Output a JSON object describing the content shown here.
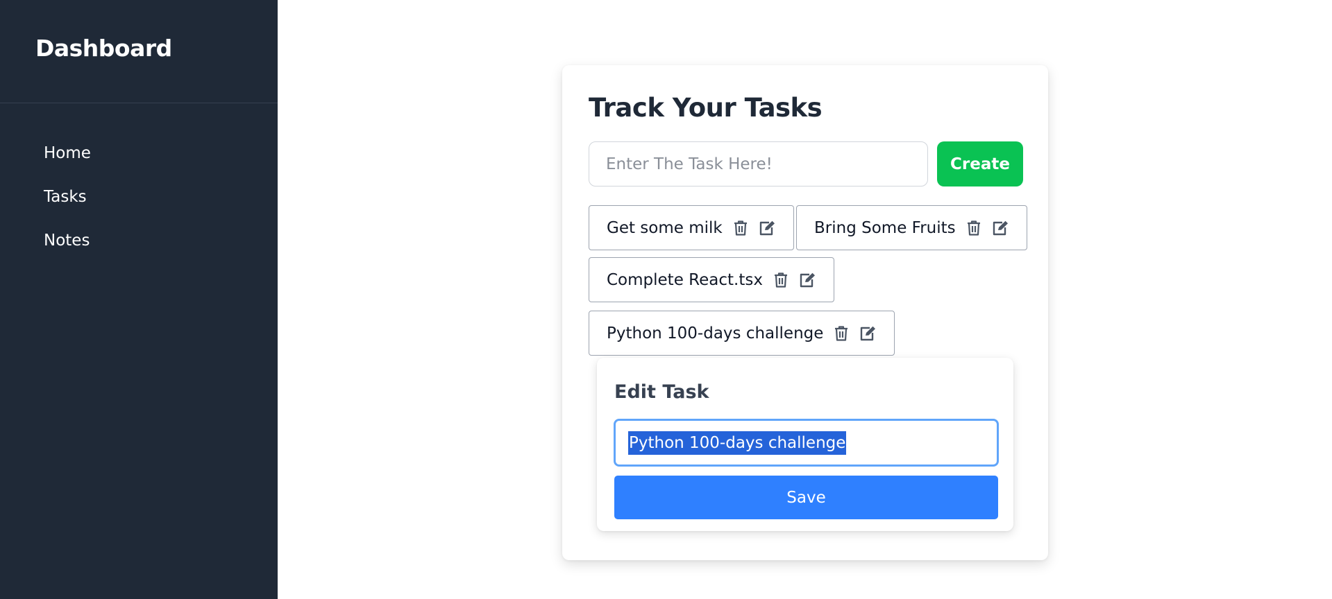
{
  "sidebar": {
    "title": "Dashboard",
    "items": [
      {
        "label": "Home"
      },
      {
        "label": "Tasks"
      },
      {
        "label": "Notes"
      }
    ]
  },
  "main": {
    "title": "Track Your Tasks",
    "input_placeholder": "Enter The Task Here!",
    "create_label": "Create",
    "tasks": [
      {
        "label": "Get some milk",
        "trash_icon": "trash-icon",
        "edit_icon": "edit-icon"
      },
      {
        "label": "Bring Some Fruits",
        "trash_icon": "trash-icon",
        "edit_icon": "edit-icon"
      },
      {
        "label": "Complete React.tsx",
        "trash_icon": "trash-icon",
        "edit_icon": "edit-icon"
      },
      {
        "label": "Python 100-days challenge",
        "trash_icon": "trash-icon",
        "edit_icon": "edit-icon"
      }
    ]
  },
  "edit_panel": {
    "title": "Edit Task",
    "value": "Python 100-days challenge",
    "save_label": "Save"
  },
  "colors": {
    "sidebar_bg": "#1f2937",
    "create_button": "#0ac253",
    "save_button": "#2f80ff",
    "selection": "#2563d9",
    "focus_ring": "#60a5fa"
  }
}
